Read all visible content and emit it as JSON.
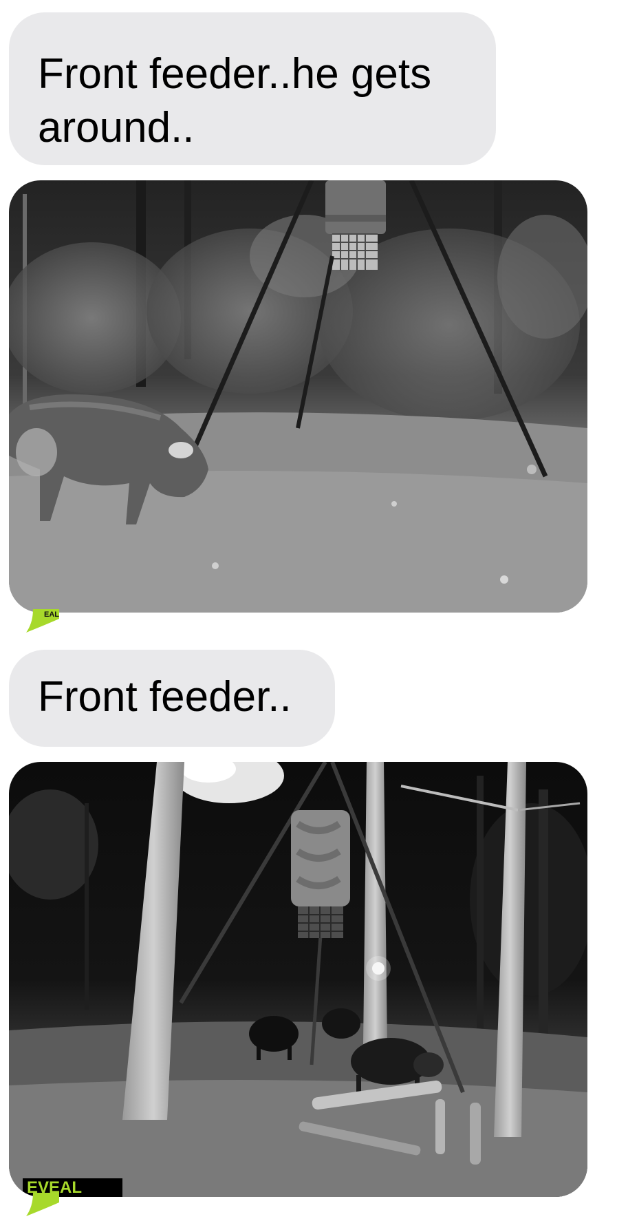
{
  "messages": [
    {
      "type": "text",
      "text": "Front feeder..he gets around.."
    },
    {
      "type": "image",
      "icon": "trail-camera-photo-hog-at-feeder-icon",
      "watermark": "EAL"
    },
    {
      "type": "text",
      "text": "Front feeder.."
    },
    {
      "type": "image",
      "icon": "trail-camera-photo-hogs-under-feeder-icon",
      "watermark": "EVEAL"
    }
  ],
  "colors": {
    "received_bubble": "#e9e9eb",
    "background": "#ffffff",
    "watermark_green": "#a7d92b"
  }
}
